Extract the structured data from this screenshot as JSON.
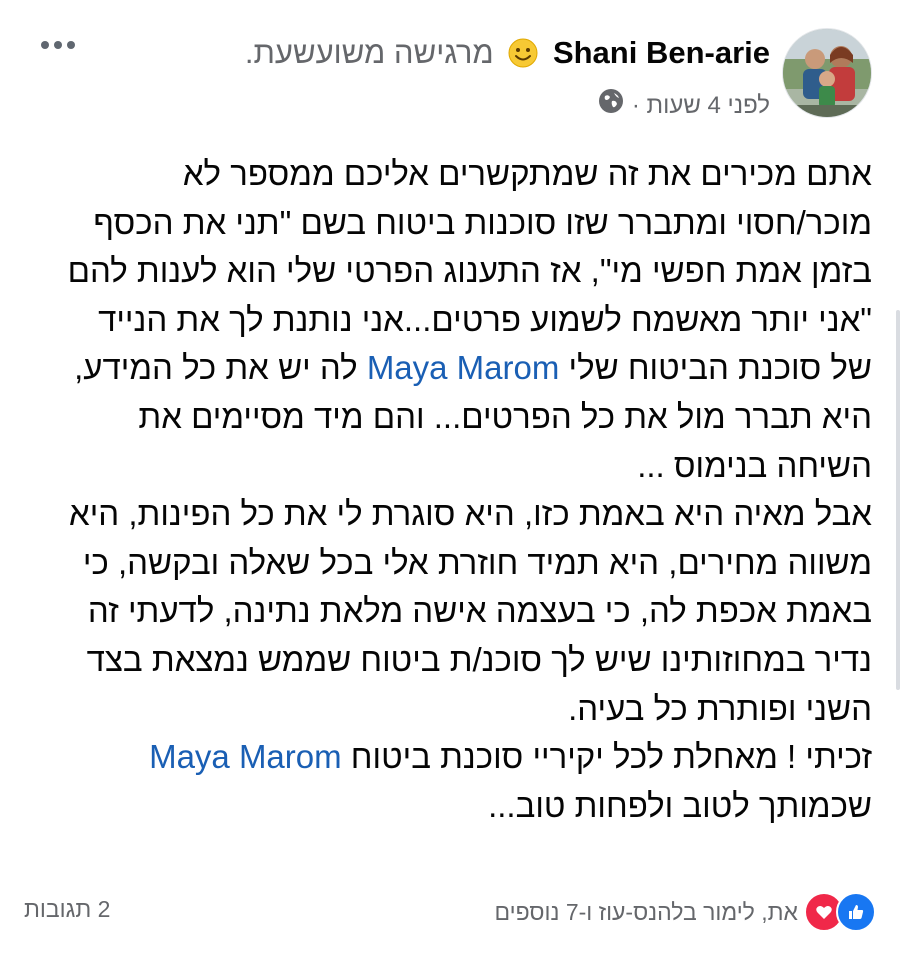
{
  "post": {
    "author": "Shani Ben-arie",
    "feeling": "מרגישה משועשעת.",
    "time": "לפני 4 שעות ·",
    "lines": [
      {
        "segments": [
          {
            "text": "אתם מכירים את זה שמתקשרים אליכם ממספר לא"
          }
        ]
      },
      {
        "segments": [
          {
            "text": "מוכר/חסוי ומתברר שזו סוכנות ביטוח בשם \"תני את הכסף"
          }
        ]
      },
      {
        "segments": [
          {
            "text": "בזמן אמת חפשי מי\", אז התענוג הפרטי שלי הוא לענות להם"
          }
        ]
      },
      {
        "segments": [
          {
            "text": "\"אני יותר מאשמח לשמוע פרטים...אני נותנת לך את הנייד"
          }
        ]
      },
      {
        "segments": [
          {
            "text": "של סוכנת הביטוח שלי "
          },
          {
            "text": "Maya Marom",
            "mention": true
          },
          {
            "text": " לה יש את כל המידע,"
          }
        ]
      },
      {
        "segments": [
          {
            "text": "היא תברר מול את כל הפרטים... והם מיד מסיימים את"
          }
        ]
      },
      {
        "segments": [
          {
            "text": "השיחה בנימוס ..."
          }
        ]
      },
      {
        "segments": [
          {
            "text": "אבל מאיה היא באמת כזו, היא סוגרת לי את כל הפינות, היא"
          }
        ]
      },
      {
        "segments": [
          {
            "text": "משווה מחירים, היא תמיד חוזרת אלי בכל שאלה ובקשה, כי"
          }
        ]
      },
      {
        "segments": [
          {
            "text": "באמת אכפת לה, כי בעצמה אישה מלאת נתינה, לדעתי זה"
          }
        ]
      },
      {
        "segments": [
          {
            "text": "נדיר במחוזותינו שיש לך סוכנ/ת ביטוח שממש נמצאת בצד"
          }
        ]
      },
      {
        "segments": [
          {
            "text": "השני ופותרת כל בעיה."
          }
        ]
      },
      {
        "segments": [
          {
            "text": "זכיתי ! מאחלת לכל יקיריי סוכנת ביטוח "
          },
          {
            "text": "Maya Marom",
            "mention": true
          }
        ]
      },
      {
        "segments": [
          {
            "text": "שכמותך לטוב ולפחות טוב..."
          }
        ]
      }
    ]
  },
  "footer": {
    "reactions_text": "את, לימור בלהנס-עוז ו-7 נוספים",
    "comments_text": "2 תגובות"
  },
  "icons": {
    "more": "more-options-icon",
    "globe": "globe-icon",
    "emoji": "smiling-face-icon",
    "like": "like-icon",
    "love": "love-icon"
  },
  "colors": {
    "mention": "#1a5fb4",
    "like": "#1877f2",
    "love": "#f02849",
    "secondary_text": "#65676b"
  }
}
